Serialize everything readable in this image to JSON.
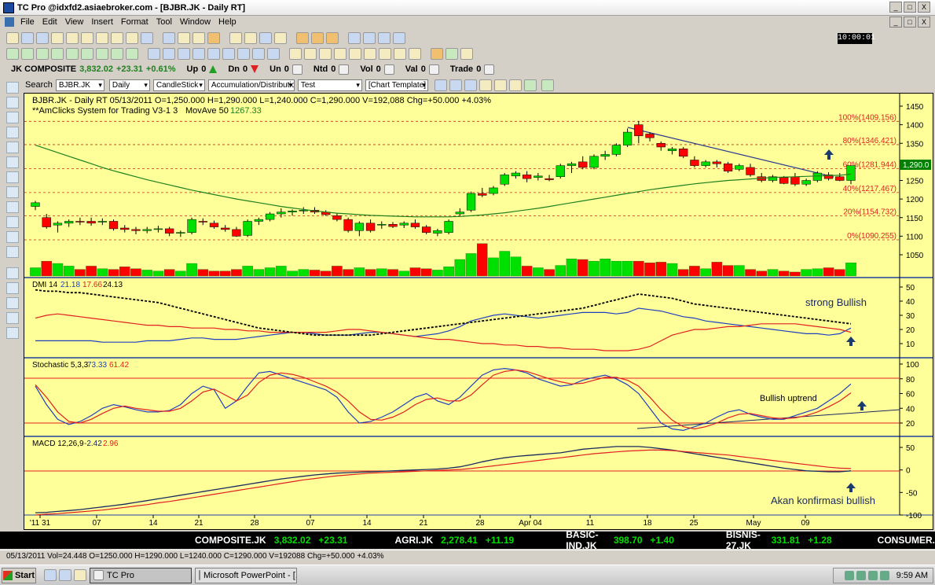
{
  "window": {
    "title": "TC Pro @idxfd2.asiaebroker.com - [BJBR.JK - Daily RT]",
    "controls": [
      "_",
      "□",
      "X"
    ]
  },
  "menu": [
    "File",
    "Edit",
    "View",
    "Insert",
    "Format",
    "Tool",
    "Window",
    "Help"
  ],
  "clock": "10:00:01",
  "ticker": {
    "index_name": "JK COMPOSITE",
    "index_value": "3,832.02",
    "index_change": "+23.31",
    "index_pct": "+0.61%",
    "up_label": "Up",
    "up_value": "0",
    "dn_label": "Dn",
    "dn_value": "0",
    "un_label": "Un",
    "un_value": "0",
    "ntd_label": "Ntd",
    "ntd_value": "0",
    "vol_label": "Vol",
    "vol_value": "0",
    "val_label": "Val",
    "val_value": "0",
    "trade_label": "Trade",
    "trade_value": "0"
  },
  "controls": {
    "search_label": "Search",
    "symbol": "BJBR.JK",
    "period": "Daily",
    "chart_type": "CandleStick",
    "indicator": "Accumulation/Distribution",
    "template_set": "Test",
    "template": "[Chart Template]"
  },
  "chart": {
    "header_line1": "BJBR.JK - Daily RT  05/13/2011   O=1,250.000   H=1,290.000   L=1,240.000   C=1,290.000   V=192,088   Chg=+50.000   +4.03%",
    "header_line2_a": "**AmClicks System for Trading V3-1 3",
    "header_line2_b": "MovAve 50",
    "header_line2_c": "1267.33",
    "last_price_tag": "1,290.0",
    "price_axis": [
      "1450",
      "1400",
      "1350",
      "1300",
      "1250",
      "1200",
      "1150",
      "1100",
      "1050"
    ],
    "fib_labels": [
      "100%(1409.156)",
      "80%(1346.421)",
      "60%(1281.944)",
      "40%(1217.467)",
      "20%(1154.732)",
      "0%(1090.255)"
    ],
    "dmi_label": "DMI 14",
    "dmi_v1": "21.18",
    "dmi_v2": "17.66",
    "dmi_v3": "24.13",
    "dmi_axis": [
      "50",
      "40",
      "30",
      "20",
      "10"
    ],
    "dmi_note": "strong Bullish",
    "stoch_label": "Stochastic 5,3,3",
    "stoch_v1": "73.33",
    "stoch_v2": "61.42",
    "stoch_axis": [
      "100",
      "80",
      "60",
      "40",
      "20"
    ],
    "stoch_note": "Bullish uptrend",
    "macd_label": "MACD 12,26,9",
    "macd_v1": "-2.42",
    "macd_v2": "2.96",
    "macd_axis": [
      "50",
      "0",
      "-50",
      "-100"
    ],
    "macd_note": "Akan konfirmasi bullish",
    "x_axis": [
      "'11 31",
      "07",
      "14",
      "21",
      "28",
      "07",
      "14",
      "21",
      "28",
      "Apr 04",
      "11",
      "18",
      "25",
      "May",
      "09"
    ]
  },
  "chart_data": {
    "type": "candlestick",
    "ylim": [
      1030,
      1460
    ],
    "candles": [
      [
        1180,
        1195,
        1170,
        1190
      ],
      [
        1150,
        1160,
        1120,
        1125
      ],
      [
        1130,
        1140,
        1110,
        1135
      ],
      [
        1135,
        1145,
        1125,
        1140
      ],
      [
        1140,
        1150,
        1130,
        1138
      ],
      [
        1140,
        1150,
        1128,
        1135
      ],
      [
        1138,
        1148,
        1130,
        1140
      ],
      [
        1140,
        1145,
        1115,
        1120
      ],
      [
        1122,
        1130,
        1110,
        1118
      ],
      [
        1118,
        1125,
        1105,
        1115
      ],
      [
        1115,
        1125,
        1108,
        1118
      ],
      [
        1118,
        1128,
        1110,
        1120
      ],
      [
        1120,
        1125,
        1100,
        1108
      ],
      [
        1108,
        1115,
        1098,
        1110
      ],
      [
        1110,
        1150,
        1105,
        1145
      ],
      [
        1140,
        1148,
        1130,
        1138
      ],
      [
        1135,
        1142,
        1120,
        1125
      ],
      [
        1122,
        1130,
        1112,
        1118
      ],
      [
        1118,
        1125,
        1098,
        1100
      ],
      [
        1102,
        1145,
        1098,
        1140
      ],
      [
        1140,
        1150,
        1130,
        1145
      ],
      [
        1145,
        1165,
        1140,
        1160
      ],
      [
        1160,
        1175,
        1150,
        1165
      ],
      [
        1165,
        1172,
        1155,
        1168
      ],
      [
        1168,
        1178,
        1160,
        1170
      ],
      [
        1170,
        1178,
        1160,
        1165
      ],
      [
        1165,
        1170,
        1155,
        1158
      ],
      [
        1155,
        1162,
        1140,
        1145
      ],
      [
        1145,
        1150,
        1110,
        1115
      ],
      [
        1115,
        1140,
        1100,
        1135
      ],
      [
        1135,
        1145,
        1110,
        1115
      ],
      [
        1130,
        1140,
        1120,
        1132
      ],
      [
        1132,
        1138,
        1122,
        1126
      ],
      [
        1130,
        1140,
        1122,
        1135
      ],
      [
        1135,
        1145,
        1120,
        1125
      ],
      [
        1125,
        1130,
        1105,
        1110
      ],
      [
        1108,
        1120,
        1100,
        1115
      ],
      [
        1110,
        1145,
        1105,
        1140
      ],
      [
        1160,
        1175,
        1155,
        1165
      ],
      [
        1170,
        1220,
        1165,
        1215
      ],
      [
        1215,
        1230,
        1205,
        1210
      ],
      [
        1215,
        1235,
        1210,
        1230
      ],
      [
        1240,
        1270,
        1235,
        1265
      ],
      [
        1262,
        1275,
        1255,
        1270
      ],
      [
        1265,
        1275,
        1245,
        1255
      ],
      [
        1258,
        1270,
        1250,
        1262
      ],
      [
        1255,
        1265,
        1248,
        1252
      ],
      [
        1260,
        1295,
        1255,
        1290
      ],
      [
        1290,
        1300,
        1270,
        1295
      ],
      [
        1300,
        1315,
        1280,
        1285
      ],
      [
        1285,
        1320,
        1280,
        1315
      ],
      [
        1315,
        1330,
        1305,
        1320
      ],
      [
        1320,
        1350,
        1315,
        1345
      ],
      [
        1345,
        1390,
        1340,
        1380
      ],
      [
        1400,
        1410,
        1350,
        1370
      ],
      [
        1375,
        1380,
        1355,
        1365
      ],
      [
        1350,
        1355,
        1330,
        1340
      ],
      [
        1330,
        1340,
        1320,
        1335
      ],
      [
        1335,
        1340,
        1310,
        1315
      ],
      [
        1305,
        1315,
        1285,
        1290
      ],
      [
        1290,
        1305,
        1285,
        1300
      ],
      [
        1300,
        1305,
        1285,
        1295
      ],
      [
        1295,
        1300,
        1270,
        1275
      ],
      [
        1280,
        1295,
        1275,
        1290
      ],
      [
        1285,
        1295,
        1260,
        1265
      ],
      [
        1260,
        1270,
        1245,
        1250
      ],
      [
        1250,
        1265,
        1245,
        1260
      ],
      [
        1258,
        1262,
        1240,
        1242
      ],
      [
        1260,
        1270,
        1235,
        1240
      ],
      [
        1240,
        1255,
        1235,
        1250
      ],
      [
        1250,
        1275,
        1245,
        1270
      ],
      [
        1265,
        1272,
        1250,
        1255
      ],
      [
        1260,
        1270,
        1248,
        1250
      ],
      [
        1250,
        1290,
        1240,
        1290
      ]
    ],
    "volume": [
      0.25,
      0.45,
      0.38,
      0.3,
      0.2,
      0.3,
      0.22,
      0.2,
      0.28,
      0.22,
      0.18,
      0.15,
      0.2,
      0.15,
      0.38,
      0.2,
      0.15,
      0.15,
      0.2,
      0.3,
      0.2,
      0.25,
      0.3,
      0.15,
      0.2,
      0.18,
      0.15,
      0.3,
      0.2,
      0.25,
      0.2,
      0.22,
      0.2,
      0.15,
      0.25,
      0.22,
      0.18,
      0.28,
      0.5,
      0.68,
      0.98,
      0.55,
      0.75,
      0.58,
      0.3,
      0.25,
      0.2,
      0.32,
      0.52,
      0.5,
      0.45,
      0.52,
      0.45,
      0.45,
      0.45,
      0.4,
      0.42,
      0.38,
      0.2,
      0.3,
      0.22,
      0.42,
      0.32,
      0.32,
      0.2,
      0.15,
      0.2,
      0.15,
      0.12,
      0.2,
      0.22,
      0.25,
      0.2,
      0.4
    ],
    "movave50": [
      1345,
      1335,
      1325,
      1315,
      1305,
      1295,
      1285,
      1276,
      1268,
      1260,
      1252,
      1245,
      1238,
      1231,
      1224,
      1218,
      1212,
      1206,
      1200,
      1195,
      1190,
      1185,
      1180,
      1176,
      1172,
      1168,
      1165,
      1162,
      1160,
      1158,
      1156,
      1155,
      1154,
      1153,
      1152,
      1152,
      1152,
      1152,
      1153,
      1155,
      1157,
      1160,
      1163,
      1167,
      1171,
      1175,
      1180,
      1185,
      1190,
      1195,
      1200,
      1205,
      1210,
      1215,
      1220,
      1225,
      1229,
      1233,
      1237,
      1241,
      1244,
      1247,
      1250,
      1252,
      1254,
      1256,
      1258,
      1259,
      1260,
      1261,
      1262,
      1263,
      1264,
      1267
    ],
    "dmi_plus": [
      12,
      12,
      12,
      12,
      12,
      12,
      11,
      11,
      11,
      11,
      12,
      12,
      12,
      13,
      14,
      14,
      13,
      13,
      13,
      14,
      15,
      16,
      17,
      18,
      18,
      17,
      16,
      16,
      16,
      17,
      18,
      18,
      17,
      16,
      15,
      16,
      17,
      19,
      22,
      26,
      28,
      30,
      31,
      30,
      29,
      28,
      29,
      30,
      31,
      32,
      32,
      32,
      31,
      32,
      35,
      34,
      33,
      31,
      29,
      28,
      26,
      25,
      24,
      23,
      22,
      21,
      20,
      19,
      18,
      17,
      17,
      16,
      17,
      21
    ],
    "dmi_minus": [
      28,
      30,
      31,
      30,
      29,
      28,
      27,
      26,
      25,
      24,
      23,
      23,
      22,
      22,
      21,
      21,
      21,
      20,
      20,
      19,
      19,
      18,
      18,
      18,
      18,
      18,
      18,
      19,
      20,
      20,
      19,
      18,
      17,
      16,
      15,
      14,
      13,
      13,
      12,
      11,
      10,
      10,
      9,
      9,
      8,
      8,
      7,
      7,
      6,
      6,
      6,
      5,
      5,
      5,
      6,
      8,
      12,
      16,
      18,
      20,
      20,
      21,
      22,
      22,
      23,
      24,
      24,
      24,
      24,
      23,
      22,
      21,
      20,
      18
    ],
    "adx": [
      48,
      47,
      47,
      46,
      46,
      45,
      44,
      43,
      42,
      41,
      40,
      39,
      37,
      35,
      33,
      31,
      29,
      27,
      25,
      23,
      21,
      20,
      19,
      18,
      17,
      16,
      16,
      16,
      16,
      16,
      16,
      17,
      18,
      19,
      20,
      21,
      22,
      23,
      24,
      25,
      26,
      27,
      28,
      29,
      30,
      31,
      32,
      33,
      34,
      35,
      37,
      39,
      41,
      43,
      45,
      44,
      43,
      42,
      40,
      38,
      37,
      36,
      35,
      34,
      33,
      32,
      31,
      30,
      29,
      28,
      27,
      26,
      25,
      24
    ],
    "stoch_k": [
      70,
      45,
      25,
      18,
      22,
      30,
      40,
      45,
      42,
      38,
      35,
      35,
      37,
      45,
      60,
      70,
      65,
      40,
      50,
      70,
      88,
      90,
      85,
      80,
      75,
      70,
      65,
      55,
      35,
      20,
      22,
      28,
      35,
      45,
      55,
      60,
      50,
      45,
      55,
      70,
      85,
      92,
      94,
      92,
      88,
      80,
      75,
      70,
      72,
      78,
      82,
      85,
      80,
      72,
      60,
      40,
      20,
      12,
      10,
      15,
      20,
      28,
      35,
      38,
      32,
      28,
      25,
      25,
      30,
      35,
      40,
      50,
      60,
      73
    ],
    "stoch_d": [
      72,
      55,
      35,
      22,
      20,
      25,
      33,
      40,
      43,
      40,
      38,
      36,
      36,
      40,
      50,
      62,
      66,
      58,
      50,
      58,
      75,
      85,
      88,
      86,
      82,
      76,
      70,
      62,
      50,
      35,
      25,
      24,
      28,
      35,
      45,
      52,
      54,
      50,
      50,
      58,
      72,
      85,
      90,
      92,
      90,
      85,
      80,
      76,
      73,
      74,
      78,
      82,
      82,
      78,
      70,
      55,
      38,
      24,
      15,
      12,
      15,
      20,
      27,
      32,
      33,
      30,
      27,
      26,
      27,
      30,
      35,
      42,
      50,
      61
    ],
    "macd": [
      -95,
      -94,
      -92,
      -90,
      -88,
      -85,
      -82,
      -79,
      -76,
      -72,
      -68,
      -64,
      -60,
      -56,
      -52,
      -48,
      -44,
      -40,
      -36,
      -32,
      -28,
      -24,
      -20,
      -17,
      -14,
      -11,
      -9,
      -7,
      -6,
      -5,
      -4,
      -3,
      -2,
      -1,
      0,
      1,
      2,
      4,
      7,
      12,
      18,
      23,
      27,
      30,
      32,
      34,
      36,
      38,
      42,
      46,
      48,
      50,
      52,
      52,
      52,
      50,
      47,
      44,
      40,
      36,
      32,
      28,
      24,
      20,
      16,
      12,
      8,
      4,
      1,
      -2,
      -3,
      -4,
      -4,
      -2
    ],
    "macd_signal": [
      -100,
      -98,
      -97,
      -95,
      -93,
      -91,
      -89,
      -86,
      -83,
      -80,
      -77,
      -73,
      -70,
      -66,
      -62,
      -58,
      -54,
      -50,
      -46,
      -42,
      -38,
      -34,
      -30,
      -26,
      -22,
      -19,
      -16,
      -13,
      -11,
      -9,
      -7,
      -6,
      -5,
      -4,
      -3,
      -2,
      -1,
      0,
      1,
      3,
      6,
      9,
      12,
      15,
      18,
      21,
      24,
      27,
      30,
      33,
      36,
      38,
      40,
      42,
      43,
      44,
      44,
      43,
      41,
      39,
      37,
      35,
      33,
      30,
      27,
      24,
      21,
      18,
      15,
      12,
      9,
      6,
      4,
      3
    ]
  },
  "statusbar": [
    {
      "sym": "COMPOSITE.JK",
      "val": "3,832.02",
      "chg": "+23.31"
    },
    {
      "sym": "AGRI.JK",
      "val": "2,278.41",
      "chg": "+11.19"
    },
    {
      "sym": "BASIC-IND.JK",
      "val": "398.70",
      "chg": "+1.40"
    },
    {
      "sym": "BISNIS-27.JK",
      "val": "331.81",
      "chg": "+1.28"
    },
    {
      "sym": "CONSUMER.",
      "val": "",
      "chg": ""
    }
  ],
  "infobar": "05/13/2011 Vol=24.448  O=1250.000  H=1290.000  L=1240.000  C=1290.000  V=192088  Chg=+50.000  +4.03%",
  "taskbar": {
    "start": "Start",
    "tasks": [
      "TC Pro",
      "Microsoft PowerPoint - [..."
    ],
    "time": "9:59 AM"
  },
  "colors": {
    "chart_bg": "#ffff99",
    "up": "#00e000",
    "down": "#ff0000",
    "ma": "#208020",
    "fib": "#e02020",
    "dmi_plus": "#2040c0",
    "dmi_minus": "#e02020",
    "adx": "#000000"
  }
}
